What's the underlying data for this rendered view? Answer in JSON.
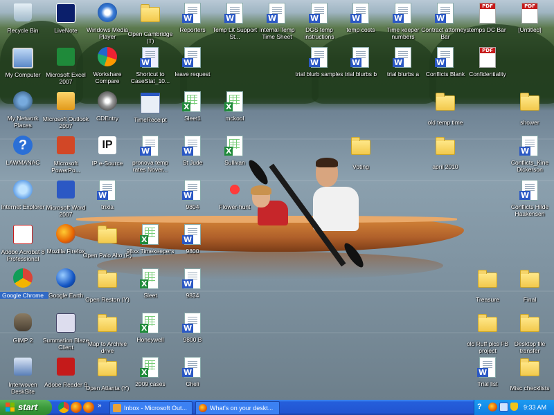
{
  "desktop": {
    "icons": [
      {
        "label": "Recycle Bin",
        "glyph": "recycle-bin-icon"
      },
      {
        "label": "LiveNote",
        "glyph": "livenote-icon"
      },
      {
        "label": "Windows Media Player",
        "glyph": "media-player-icon"
      },
      {
        "label": "Open Cambridge (T)",
        "glyph": "folder-icon"
      },
      {
        "label": "Reporters",
        "glyph": "word-doc-icon"
      },
      {
        "label": "Temp Lit Support St...",
        "glyph": "word-doc-icon"
      },
      {
        "label": "Internal Temp Time Sheet",
        "glyph": "word-doc-icon"
      },
      {
        "label": "DGS temp instructions",
        "glyph": "word-doc-icon"
      },
      {
        "label": "temp costs",
        "glyph": "word-doc-icon"
      },
      {
        "label": "Time keeper numbers",
        "glyph": "word-doc-icon"
      },
      {
        "label": "Contract attorneys Bar",
        "glyph": "word-doc-icon"
      },
      {
        "label": "temps DC Bar",
        "glyph": "pdf-icon"
      },
      {
        "label": "[Untitled]",
        "glyph": "pdf-icon"
      },
      {
        "label": "My Computer",
        "glyph": "my-computer-icon"
      },
      {
        "label": "Microsoft Excel 2007",
        "glyph": "excel-icon"
      },
      {
        "label": "Workshare Compare",
        "glyph": "workshare-icon"
      },
      {
        "label": "Shortcut to CaseStat_10...",
        "glyph": "shortcut-doc-icon"
      },
      {
        "label": "leave request",
        "glyph": "word-doc-icon"
      },
      {
        "label": "trial blurb samples",
        "glyph": "word-doc-icon"
      },
      {
        "label": "trial blurbs b",
        "glyph": "word-doc-icon"
      },
      {
        "label": "trial blurbs a",
        "glyph": "word-doc-icon"
      },
      {
        "label": "Conflicts Blank",
        "glyph": "word-doc-icon"
      },
      {
        "label": "Confidentiality",
        "glyph": "pdf-icon"
      },
      {
        "label": "My Network Places",
        "glyph": "network-places-icon"
      },
      {
        "label": "Microsoft Outlook 2007",
        "glyph": "outlook-icon"
      },
      {
        "label": "CDEntry",
        "glyph": "cdentry-icon"
      },
      {
        "label": "TimeReceipt",
        "glyph": "app-window-icon"
      },
      {
        "label": "Sleet1",
        "glyph": "excel-doc-icon"
      },
      {
        "label": "mckool",
        "glyph": "excel-doc-icon"
      },
      {
        "label": "old temp time",
        "glyph": "folder-icon"
      },
      {
        "label": "shower",
        "glyph": "folder-icon"
      },
      {
        "label": "LAWMANAC",
        "glyph": "help-icon"
      },
      {
        "label": "Microsoft PowerPo...",
        "glyph": "powerpoint-icon"
      },
      {
        "label": "IP e-Source",
        "glyph": "ip-esource-icon"
      },
      {
        "label": "pronova temp rates Nover...",
        "glyph": "word-doc-icon"
      },
      {
        "label": "St Jude",
        "glyph": "word-doc-icon"
      },
      {
        "label": "Sullivan",
        "glyph": "excel-doc-icon"
      },
      {
        "label": "Voting",
        "glyph": "folder-icon"
      },
      {
        "label": "april 2010",
        "glyph": "folder-icon"
      },
      {
        "label": "Conflicts_Kine Dickerson",
        "glyph": "word-doc-icon"
      },
      {
        "label": "Internet Explorer",
        "glyph": "ie-icon"
      },
      {
        "label": "Microsoft Word 2007",
        "glyph": "word-icon"
      },
      {
        "label": "trixia",
        "glyph": "word-doc-icon"
      },
      {
        "label": "9804",
        "glyph": "word-doc-icon"
      },
      {
        "label": "Flower-hunt",
        "glyph": "flower-hunt-icon"
      },
      {
        "label": "Conflicts Hilde Haakensen",
        "glyph": "word-doc-icon"
      },
      {
        "label": "Adobe Acrobat 8 Professional",
        "glyph": "acrobat-icon"
      },
      {
        "label": "Mozilla Firefox",
        "glyph": "firefox-icon"
      },
      {
        "label": "Open Palo Alto (P)",
        "glyph": "folder-icon"
      },
      {
        "label": "98xx Timekeepers",
        "glyph": "excel-doc-icon"
      },
      {
        "label": "9800",
        "glyph": "word-doc-icon"
      },
      {
        "label": "Google Chrome",
        "glyph": "chrome-icon"
      },
      {
        "label": "Google Earth",
        "glyph": "google-earth-icon"
      },
      {
        "label": "Open Reston (Y)",
        "glyph": "folder-icon"
      },
      {
        "label": "Sleet",
        "glyph": "excel-doc-icon"
      },
      {
        "label": "9834",
        "glyph": "word-doc-icon"
      },
      {
        "label": "Treasure",
        "glyph": "folder-icon"
      },
      {
        "label": "Final",
        "glyph": "folder-icon"
      },
      {
        "label": "GIMP 2",
        "glyph": "gimp-icon"
      },
      {
        "label": "Summation Blaze Client",
        "glyph": "summation-icon"
      },
      {
        "label": "Map to Archive drive",
        "glyph": "folder-icon"
      },
      {
        "label": "Honeywell",
        "glyph": "excel-doc-icon"
      },
      {
        "label": "9800 B",
        "glyph": "word-doc-icon"
      },
      {
        "label": "old Ruff pics FB project",
        "glyph": "folder-icon"
      },
      {
        "label": "Desktop file transfer",
        "glyph": "folder-icon"
      },
      {
        "label": "Interwoven DeskSite",
        "glyph": "desksite-icon"
      },
      {
        "label": "Adobe Reader 9",
        "glyph": "adobe-reader-icon"
      },
      {
        "label": "Open Atlanta (Y)",
        "glyph": "folder-icon"
      },
      {
        "label": "2009 cases",
        "glyph": "excel-doc-icon"
      },
      {
        "label": "Cheli",
        "glyph": "word-doc-icon"
      },
      {
        "label": "Trial list",
        "glyph": "word-doc-icon"
      },
      {
        "label": "Misc checklists",
        "glyph": "folder-icon"
      }
    ]
  },
  "taskbar": {
    "start_label": "start",
    "quicklaunch": [
      "chrome-icon",
      "firefox-icon",
      "firefox-icon"
    ],
    "overflow": "»",
    "tasks": [
      {
        "label": "Inbox - Microsoft Out...",
        "icon": "outlook-icon"
      },
      {
        "label": "What's on your deskt...",
        "icon": "firefox-icon"
      }
    ],
    "tray_icons": [
      "help-icon",
      "firefox-icon",
      "network-icon",
      "shield-icon"
    ],
    "clock": "9:33 AM"
  },
  "colors": {
    "taskbar": "#245edb",
    "start_button": "#3c9b3c",
    "selection": "#316ac5"
  }
}
